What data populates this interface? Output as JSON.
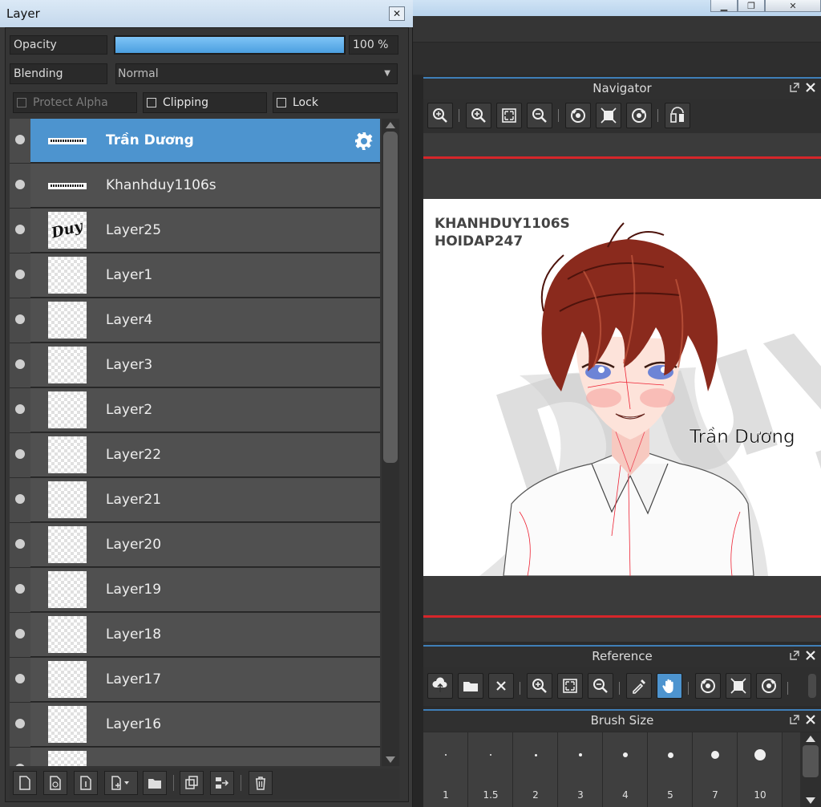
{
  "layer_window": {
    "title": "Layer",
    "close_glyph": "✕",
    "opacity_label": "Opacity",
    "opacity_value": "100 %",
    "opacity_fraction": 1.0,
    "blending_label": "Blending",
    "blending_value": "Normal",
    "protect_alpha_label": "Protect Alpha",
    "clipping_label": "Clipping",
    "lock_label": "Lock",
    "layers": [
      {
        "name": "Trần Dương",
        "selected": true,
        "thumb": "text"
      },
      {
        "name": "Khanhduy1106s",
        "selected": false,
        "thumb": "text"
      },
      {
        "name": "Layer25",
        "selected": false,
        "thumb": "duy"
      },
      {
        "name": "Layer1",
        "selected": false,
        "thumb": "checker"
      },
      {
        "name": "Layer4",
        "selected": false,
        "thumb": "checker"
      },
      {
        "name": "Layer3",
        "selected": false,
        "thumb": "checker"
      },
      {
        "name": "Layer2",
        "selected": false,
        "thumb": "checker"
      },
      {
        "name": "Layer22",
        "selected": false,
        "thumb": "checker"
      },
      {
        "name": "Layer21",
        "selected": false,
        "thumb": "checker"
      },
      {
        "name": "Layer20",
        "selected": false,
        "thumb": "checker"
      },
      {
        "name": "Layer19",
        "selected": false,
        "thumb": "checker"
      },
      {
        "name": "Layer18",
        "selected": false,
        "thumb": "checker"
      },
      {
        "name": "Layer17",
        "selected": false,
        "thumb": "checker"
      },
      {
        "name": "Layer16",
        "selected": false,
        "thumb": "checker"
      },
      {
        "name": "",
        "selected": false,
        "thumb": "checker"
      }
    ],
    "thumb_duy_text": "Duy"
  },
  "navigator": {
    "title": "Navigator",
    "artwork_text_1": "KHANHDUY1106S",
    "artwork_text_2": "HOIDAP247",
    "artwork_signature": "Trần Dương"
  },
  "reference": {
    "title": "Reference"
  },
  "brush_size": {
    "title": "Brush Size",
    "sizes": [
      "1",
      "1.5",
      "2",
      "3",
      "4",
      "5",
      "7",
      "10"
    ]
  },
  "colors": {
    "accent": "#4d94cf",
    "panel_bg": "#353535",
    "red_guide": "#d6262a",
    "hair": "#8a2a1d"
  }
}
